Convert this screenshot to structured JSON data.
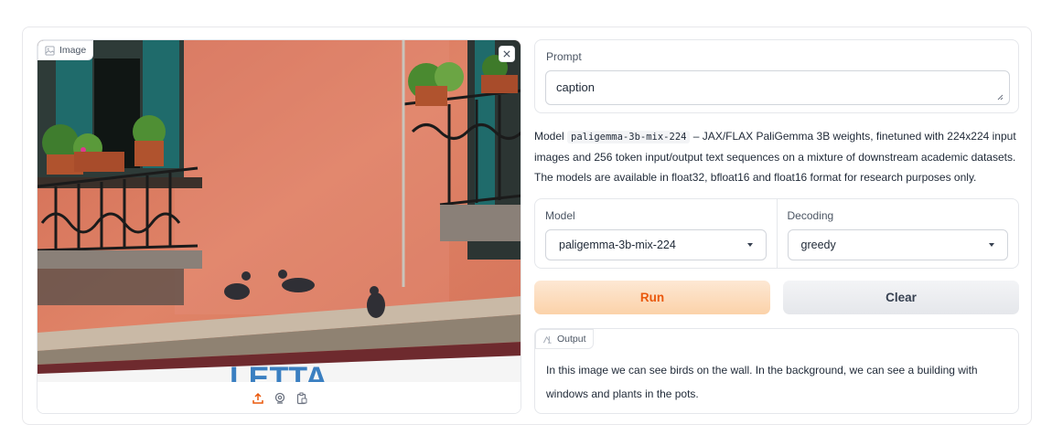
{
  "image_panel": {
    "label": "Image",
    "icons": [
      "image-icon",
      "close-icon",
      "upload-icon",
      "webcam-icon",
      "clipboard-icon"
    ],
    "sign_text": "LETTA"
  },
  "prompt": {
    "label": "Prompt",
    "value": "caption"
  },
  "description": {
    "prefix": "Model ",
    "model_code": "paligemma-3b-mix-224",
    "text": " – JAX/FLAX PaliGemma 3B weights, finetuned with 224x224 input images and 256 token input/output text sequences on a mixture of downstream academic datasets. The models are available in float32, bfloat16 and float16 format for research purposes only."
  },
  "model_select": {
    "label": "Model",
    "value": "paligemma-3b-mix-224"
  },
  "decoding_select": {
    "label": "Decoding",
    "value": "greedy"
  },
  "buttons": {
    "run": "Run",
    "clear": "Clear"
  },
  "output": {
    "label": "Output",
    "text": "In this image we can see birds on the wall. In the background, we can see a building with windows and plants in the pots."
  },
  "colors": {
    "accent": "#ea580c",
    "run_bg": "#fbd2a9",
    "wall": "#d9735a"
  }
}
